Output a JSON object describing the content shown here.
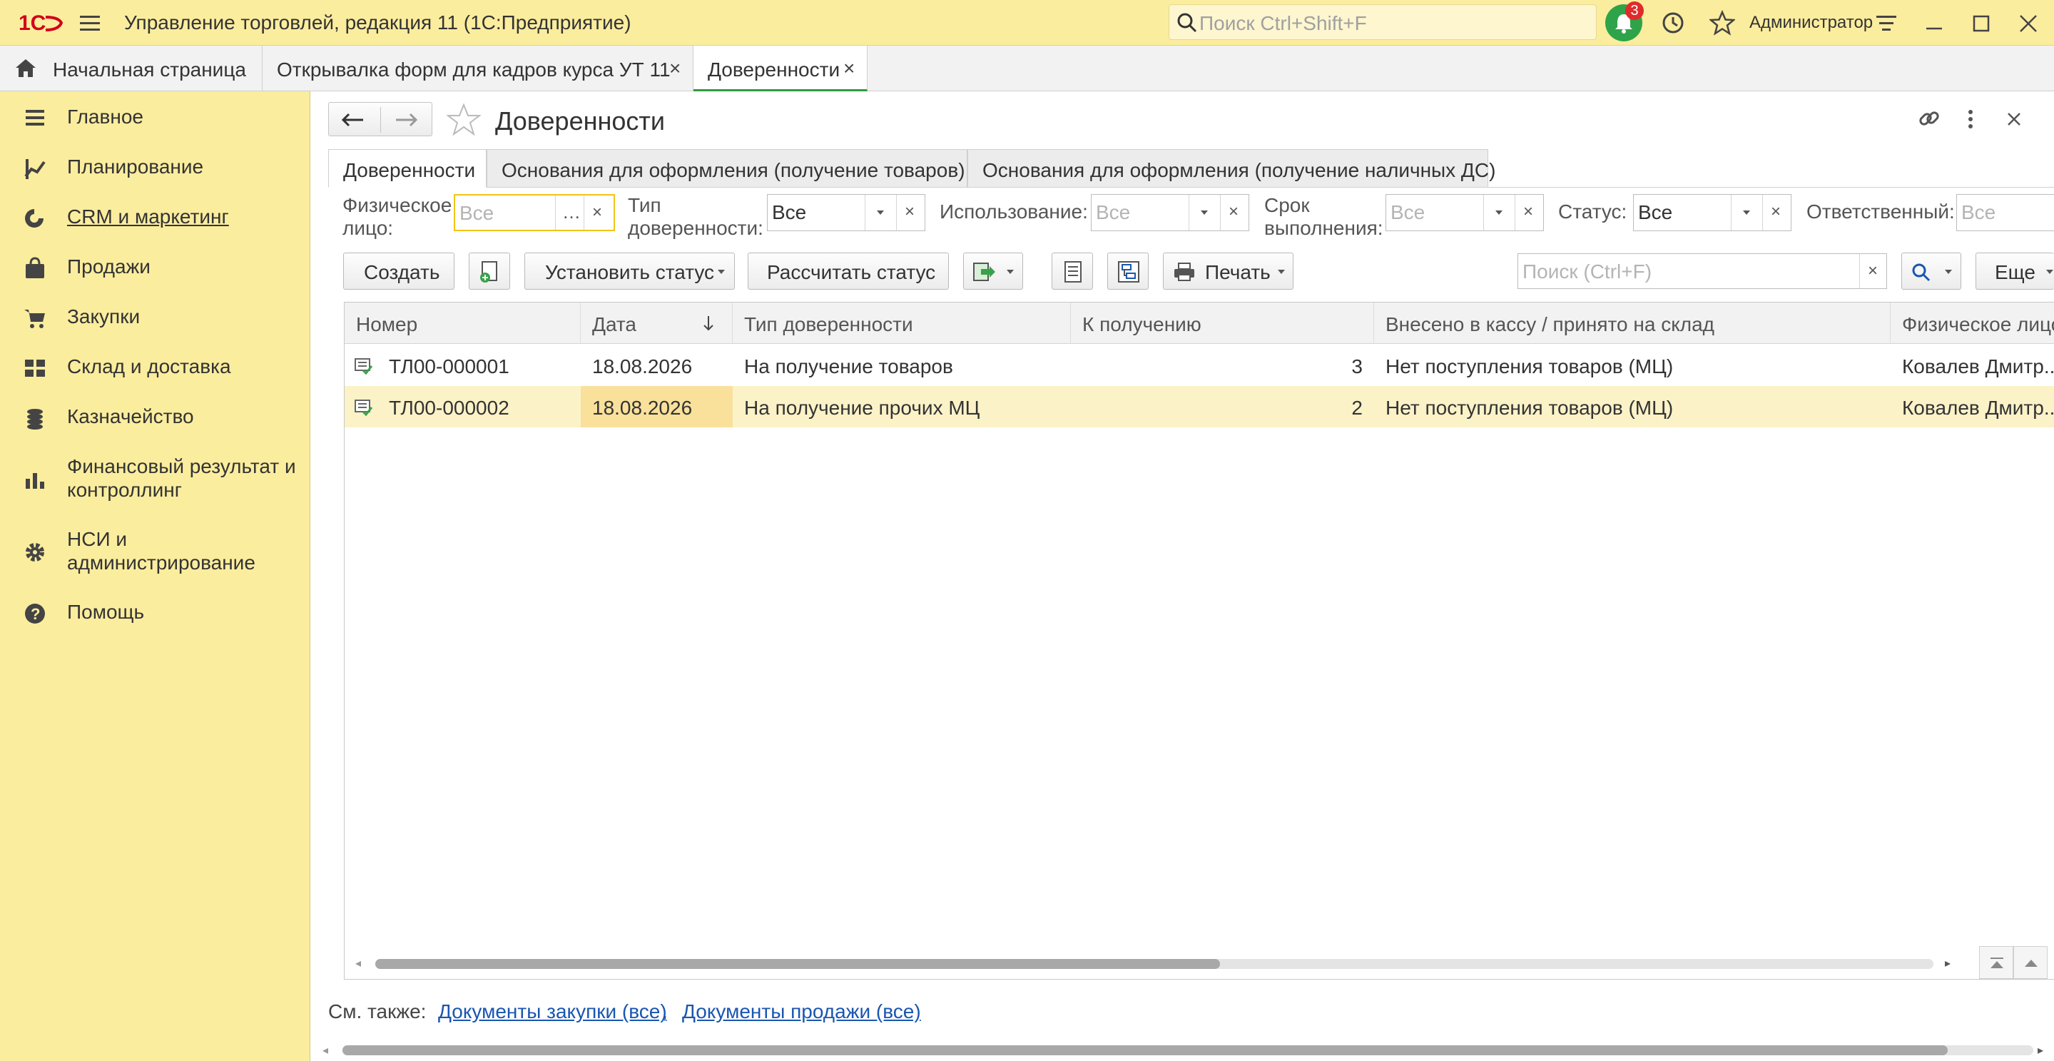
{
  "titlebar": {
    "app_title": "Управление торговлей, редакция 11  (1С:Предприятие)",
    "search_placeholder": "Поиск Ctrl+Shift+F",
    "notifications_count": "3",
    "user": "Администратор"
  },
  "tabs": [
    {
      "label": "Начальная страница"
    },
    {
      "label": "Открывалка форм для кадров курса УТ 11"
    },
    {
      "label": "Доверенности"
    }
  ],
  "sidebar": {
    "items": [
      {
        "label": "Главное",
        "icon": "menu-icon"
      },
      {
        "label": "Планирование",
        "icon": "planning-icon"
      },
      {
        "label": "CRM и маркетинг",
        "icon": "crm-icon"
      },
      {
        "label": "Продажи",
        "icon": "bag-icon"
      },
      {
        "label": "Закупки",
        "icon": "cart-icon"
      },
      {
        "label": "Склад и доставка",
        "icon": "warehouse-icon"
      },
      {
        "label": "Казначейство",
        "icon": "coins-icon"
      },
      {
        "label": "Финансовый результат и контроллинг",
        "icon": "bar-chart-icon"
      },
      {
        "label": "НСИ и администрирование",
        "icon": "gear-icon"
      },
      {
        "label": "Помощь",
        "icon": "help-icon"
      }
    ]
  },
  "form": {
    "title": "Доверенности",
    "form_tabs": [
      {
        "label": "Доверенности"
      },
      {
        "label": "Основания для оформления (получение товаров)"
      },
      {
        "label": "Основания для оформления (получение наличных ДС)"
      }
    ],
    "filters": {
      "person_label": "Физическое лицо:",
      "person_placeholder": "Все",
      "type_label": "Тип доверенности:",
      "type_value": "Все",
      "usage_label": "Использование:",
      "usage_placeholder": "Все",
      "term_label": "Срок выполнения:",
      "term_placeholder": "Все",
      "status_label": "Статус:",
      "status_value": "Все",
      "responsible_label": "Ответственный:",
      "responsible_placeholder": "Все"
    },
    "toolbar": {
      "create": "Создать",
      "set_status": "Установить статус",
      "calc_status": "Рассчитать статус",
      "print": "Печать",
      "search_placeholder": "Поиск (Ctrl+F)",
      "more": "Еще"
    },
    "table": {
      "columns": [
        "Номер",
        "Дата",
        "Тип доверенности",
        "К получению",
        "Внесено в кассу / принято на склад",
        "Физическое лицо"
      ],
      "rows": [
        {
          "number": "ТЛ00-000001",
          "date": "18.08.2026",
          "type": "На получение товаров",
          "qty": "3",
          "received": "Нет поступления товаров (МЦ)",
          "person": "Ковалев Дмитр..."
        },
        {
          "number": "ТЛ00-000002",
          "date": "18.08.2026",
          "type": "На получение прочих МЦ",
          "qty": "2",
          "received": "Нет поступления товаров (МЦ)",
          "person": "Ковалев Дмитр..."
        }
      ],
      "selected_row": 1
    },
    "see_also": {
      "label": "См. также:",
      "link1": "Документы закупки (все)",
      "comma": ",",
      "link2": "Документы продажи (все)"
    }
  },
  "colors": {
    "accent_yellow": "#fbed9e",
    "selected_row": "#fcf2c8",
    "selected_cell": "#f9e19c",
    "link": "#1a56b0",
    "active_tab_underline": "#2f9a41"
  }
}
